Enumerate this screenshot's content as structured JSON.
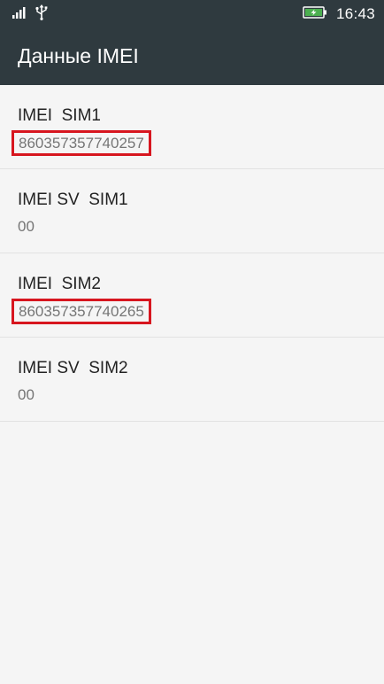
{
  "status_bar": {
    "time": "16:43",
    "icons": [
      "signal-icon",
      "usb-icon",
      "battery-charging-icon"
    ]
  },
  "app_bar": {
    "title": "Данные IMEI"
  },
  "items": [
    {
      "title": "IMEI  SIM1",
      "value": "860357357740257",
      "highlighted": true
    },
    {
      "title": "IMEI SV  SIM1",
      "value": "00",
      "highlighted": false
    },
    {
      "title": "IMEI  SIM2",
      "value": "860357357740265",
      "highlighted": true
    },
    {
      "title": "IMEI SV  SIM2",
      "value": "00",
      "highlighted": false
    }
  ],
  "colors": {
    "bar": "#2f3a3f",
    "background": "#f5f5f5",
    "highlight_border": "#d7161f",
    "battery": "#4caf50"
  }
}
